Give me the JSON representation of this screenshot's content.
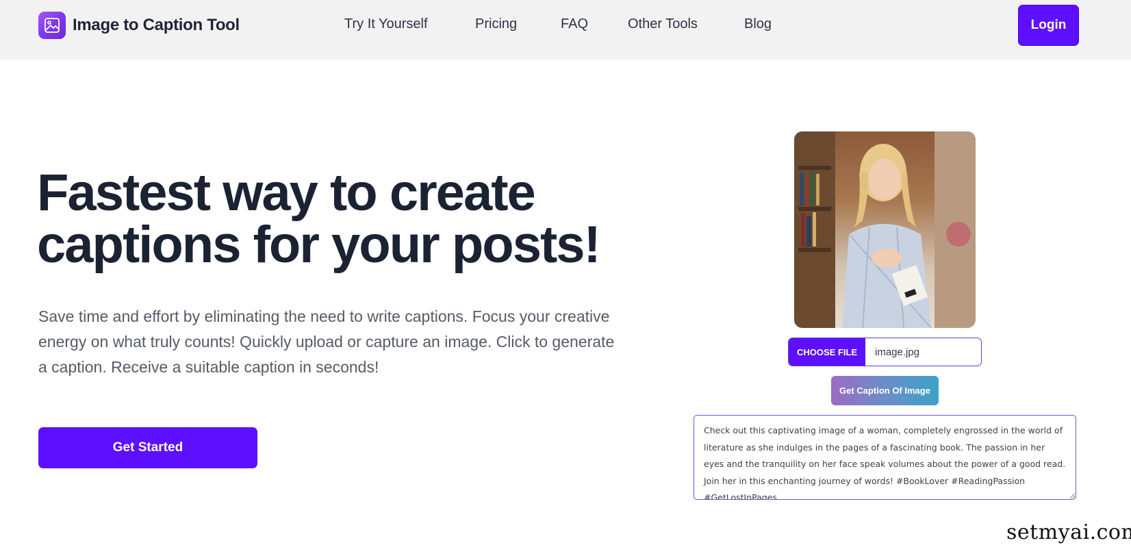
{
  "brand": {
    "name": "Image to Caption Tool",
    "icon": "image-icon"
  },
  "nav": {
    "links": [
      "Try It Yourself",
      "Pricing",
      "FAQ",
      "Other Tools",
      "Blog"
    ],
    "login_label": "Login"
  },
  "hero": {
    "title": "Fastest way to create captions for your posts!",
    "description": "Save time and effort by eliminating the need to write captions. Focus your creative energy on what truly counts! Quickly upload or capture an image. Click to generate a caption. Receive a suitable caption in seconds!",
    "cta_label": "Get Started"
  },
  "tool": {
    "choose_file_label": "CHOOSE FILE",
    "file_name": "image.jpg",
    "generate_label": "Get Caption Of Image",
    "caption": "Check out this captivating image of a woman, completely engrossed in the world of literature as she indulges in the pages of a fascinating book. The passion in her eyes and the tranquility on her face speak volumes about the power of a good read. Join her in this enchanting journey of words! #BookLover #ReadingPassion #GetLostInPages"
  },
  "watermark": "setmyai.com",
  "colors": {
    "accent": "#5c10ff",
    "title": "#1b2333",
    "navbar_bg": "#f2f2f2"
  }
}
